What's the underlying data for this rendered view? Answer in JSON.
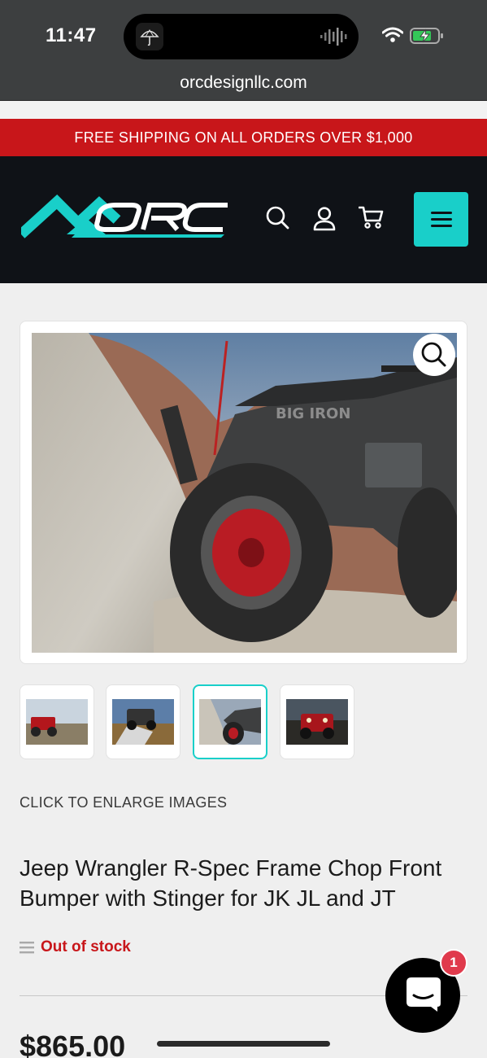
{
  "status_bar": {
    "time": "11:47"
  },
  "browser": {
    "url": "orcdesignllc.com"
  },
  "promo_banner": {
    "text": "FREE SHIPPING ON ALL ORDERS OVER $1,000"
  },
  "header": {
    "logo_text": "ORC",
    "brand_color": "#19cfc9",
    "icons": [
      "search-icon",
      "account-icon",
      "cart-icon",
      "menu-icon"
    ]
  },
  "gallery": {
    "main_image_alt": "Jeep on rocky slope",
    "thumbnail_count": 4,
    "active_thumbnail": 3,
    "enlarge_label": "CLICK TO ENLARGE IMAGES"
  },
  "product": {
    "title": "Jeep Wrangler R-Spec Frame Chop Front Bumper with Stinger for JK JL and JT",
    "stock_status": "Out of stock",
    "price": "$865.00"
  },
  "chat": {
    "badge_count": "1"
  },
  "colors": {
    "accent": "#19cfc9",
    "alert": "#c8161a",
    "header_bg": "#0f1217"
  }
}
